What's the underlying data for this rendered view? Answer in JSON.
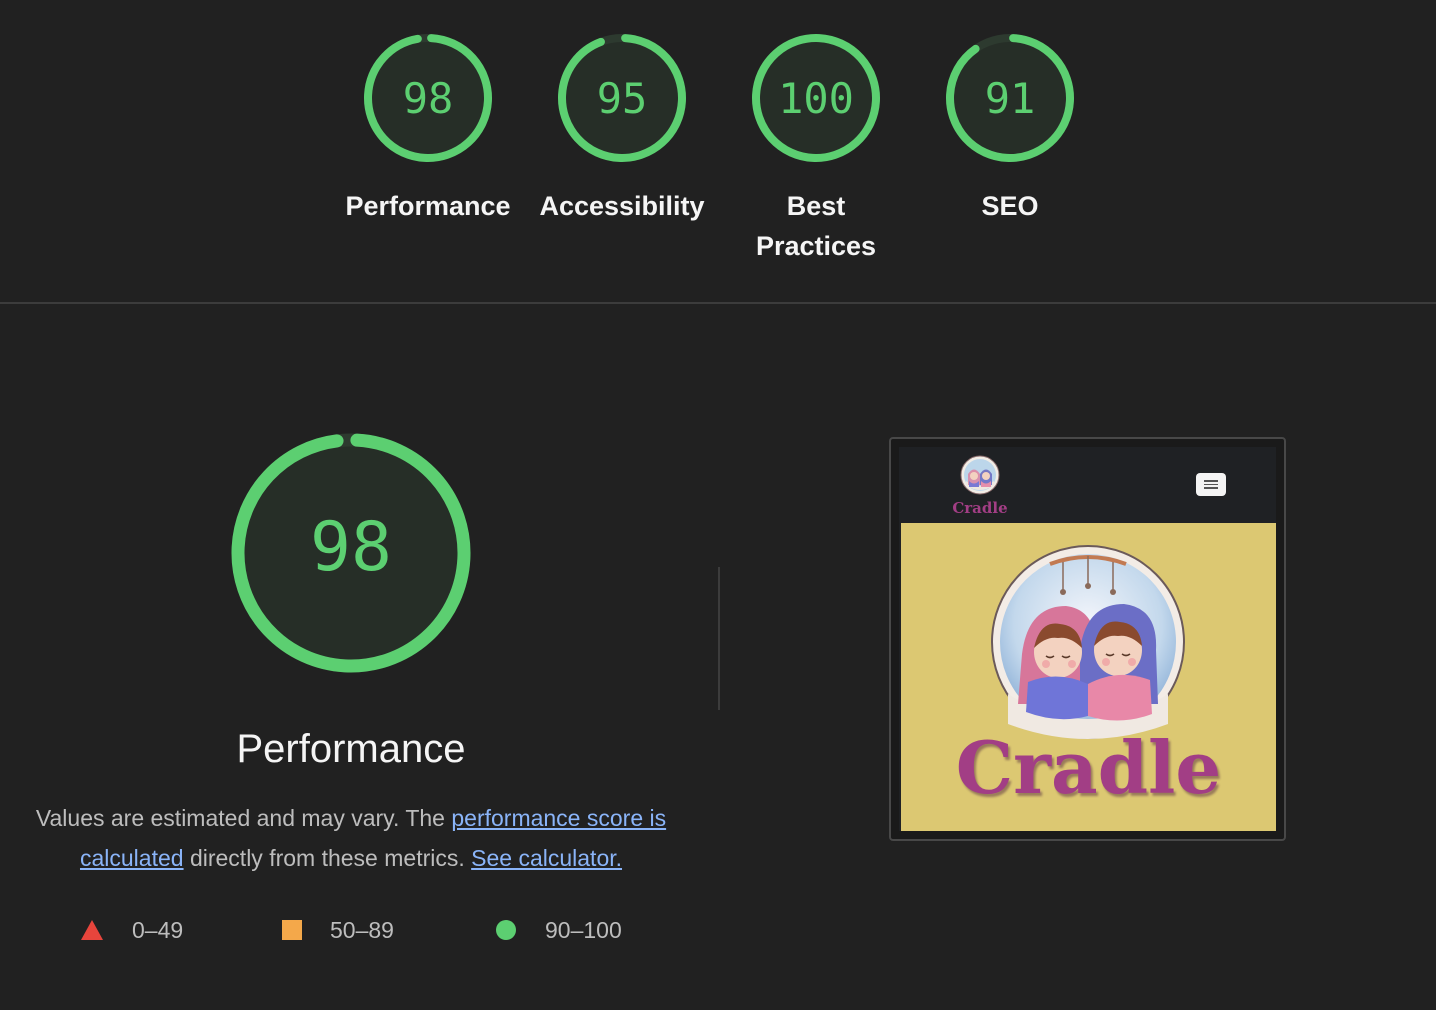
{
  "summary": {
    "gauges": [
      {
        "score": "98",
        "value": 98,
        "label_line1": "Performance",
        "label_line2": ""
      },
      {
        "score": "95",
        "value": 95,
        "label_line1": "Accessibility",
        "label_line2": ""
      },
      {
        "score": "100",
        "value": 100,
        "label_line1": "Best",
        "label_line2": "Practices"
      },
      {
        "score": "91",
        "value": 91,
        "label_line1": "SEO",
        "label_line2": ""
      }
    ]
  },
  "performance": {
    "score": "98",
    "value": 98,
    "title": "Performance",
    "desc_part1": "Values are estimated and may vary. The ",
    "link1": "performance score is calculated",
    "desc_part2": " directly from these metrics. ",
    "link2": "See calculator."
  },
  "legend": {
    "fail": "0–49",
    "average": "50–89",
    "pass": "90–100"
  },
  "screenshot": {
    "nav_brand": "Cradle",
    "hero_title": "Cradle"
  },
  "colors": {
    "pass": "#5ccf71",
    "average": "#f4a84a",
    "fail": "#e8453c",
    "gauge_fill": "#262e27",
    "background": "#212121",
    "link": "#8ab4f8",
    "brand": "#a23e85",
    "hero_bg": "#dcc872"
  }
}
